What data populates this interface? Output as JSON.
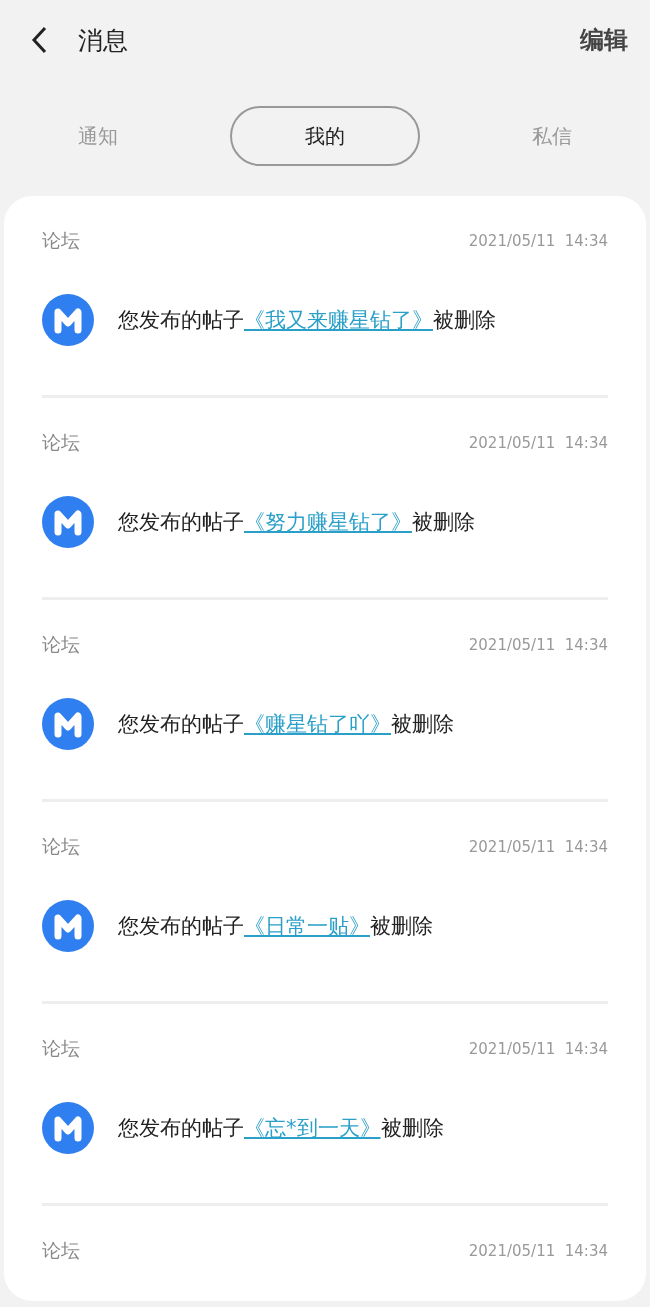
{
  "header": {
    "title": "消息",
    "action": "编辑"
  },
  "tabs": [
    {
      "label": "通知",
      "selected": false
    },
    {
      "label": "我的",
      "selected": true
    },
    {
      "label": "私信",
      "selected": false
    }
  ],
  "messages": [
    {
      "source": "论坛",
      "time": "2021/05/11  14:34",
      "prefix": "您发布的帖子",
      "title": "《我又来赚星钻了》",
      "suffix": "被删除"
    },
    {
      "source": "论坛",
      "time": "2021/05/11  14:34",
      "prefix": "您发布的帖子",
      "title": "《努力赚星钻了》",
      "suffix": "被删除"
    },
    {
      "source": "论坛",
      "time": "2021/05/11  14:34",
      "prefix": "您发布的帖子",
      "title": "《赚星钻了吖》",
      "suffix": "被删除"
    },
    {
      "source": "论坛",
      "time": "2021/05/11  14:34",
      "prefix": "您发布的帖子",
      "title": "《日常一贴》",
      "suffix": "被删除"
    },
    {
      "source": "论坛",
      "time": "2021/05/11  14:34",
      "prefix": "您发布的帖子",
      "title": "《忘*到一天》",
      "suffix": "被删除"
    },
    {
      "source": "论坛",
      "time": "2021/05/11  14:34"
    }
  ]
}
